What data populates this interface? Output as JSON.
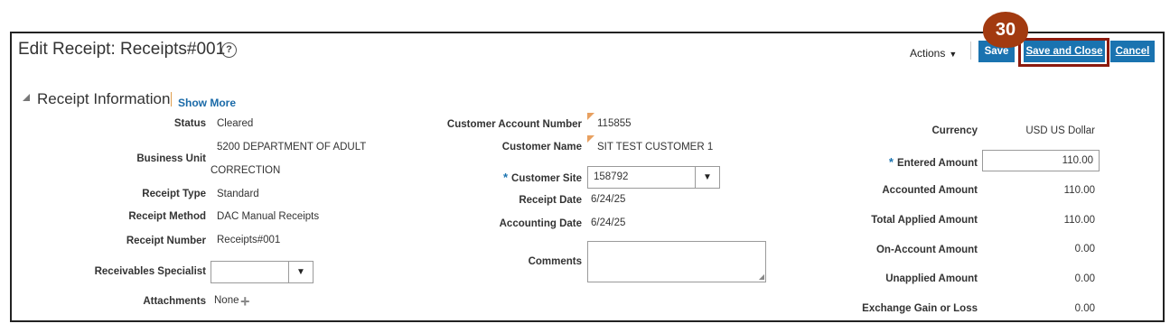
{
  "header": {
    "title": "Edit Receipt: Receipts#001",
    "help_icon": "?",
    "actions_label": "Actions",
    "save_label": "Save",
    "save_close_label": "Save and Close",
    "cancel_label": "Cancel",
    "step_badge": "30"
  },
  "section": {
    "title": "Receipt Information",
    "show_more": "Show More"
  },
  "left": {
    "status_label": "Status",
    "status_value": "Cleared",
    "bu_label": "Business Unit",
    "bu_value_1": "5200 DEPARTMENT OF ADULT",
    "bu_value_2": "CORRECTION",
    "type_label": "Receipt Type",
    "type_value": "Standard",
    "method_label": "Receipt Method",
    "method_value": "DAC Manual Receipts",
    "number_label": "Receipt Number",
    "number_value": "Receipts#001",
    "specialist_label": "Receivables Specialist",
    "specialist_value": "",
    "attachments_label": "Attachments",
    "attachments_value": "None"
  },
  "middle": {
    "acct_label": "Customer Account Number",
    "acct_value": "115855",
    "name_label": "Customer Name",
    "name_value": "SIT TEST CUSTOMER 1",
    "site_label": "Customer Site",
    "site_value": "158792",
    "rdate_label": "Receipt Date",
    "rdate_value": "6/24/25",
    "adate_label": "Accounting Date",
    "adate_value": "6/24/25",
    "comments_label": "Comments",
    "comments_value": ""
  },
  "right": {
    "currency_label": "Currency",
    "currency_value": "USD US Dollar",
    "entered_label": "Entered Amount",
    "entered_value": "110.00",
    "accounted_label": "Accounted Amount",
    "accounted_value": "110.00",
    "applied_label": "Total Applied Amount",
    "applied_value": "110.00",
    "onaccount_label": "On-Account Amount",
    "onaccount_value": "0.00",
    "unapplied_label": "Unapplied Amount",
    "unapplied_value": "0.00",
    "exchange_label": "Exchange Gain or Loss",
    "exchange_value": "0.00"
  },
  "colors": {
    "accent": "#1a73b0",
    "highlight": "#8b1a0e",
    "badge": "#a23a10"
  },
  "icons": {
    "help": "help-icon",
    "dropdown": "chevron-down-icon",
    "add": "plus-icon",
    "collapse": "triangle-icon"
  }
}
